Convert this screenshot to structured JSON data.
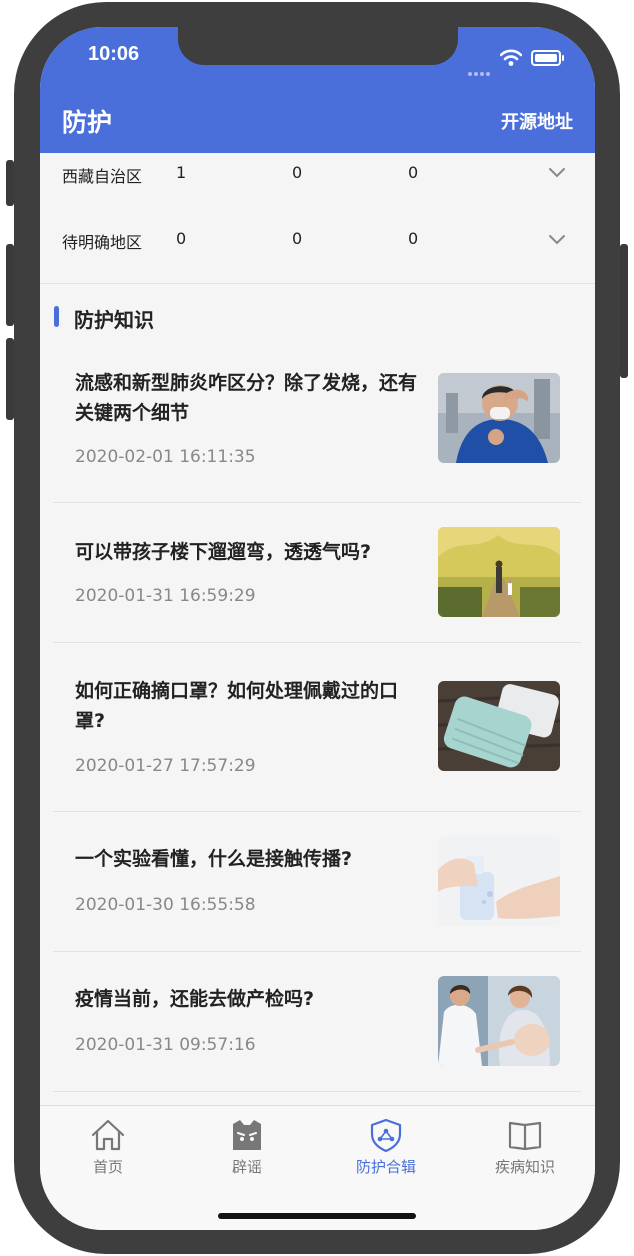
{
  "status_bar": {
    "time": "10:06"
  },
  "header": {
    "title": "防护",
    "link": "开源地址"
  },
  "regions": [
    {
      "name": "西藏自治区",
      "values": [
        "1",
        "0",
        "0"
      ]
    },
    {
      "name": "待明确地区",
      "values": [
        "0",
        "0",
        "0"
      ]
    }
  ],
  "section": {
    "title": "防护知识"
  },
  "articles": [
    {
      "title": "流感和新型肺炎咋区分？除了发烧，还有关键两个细节",
      "date": "2020-02-01 16:11:35"
    },
    {
      "title": "可以带孩子楼下遛遛弯，透透气吗?",
      "date": "2020-01-31 16:59:29"
    },
    {
      "title": "如何正确摘口罩？如何处理佩戴过的口罩?",
      "date": "2020-01-27 17:57:29"
    },
    {
      "title": "一个实验看懂，什么是接触传播?",
      "date": "2020-01-30 16:55:58"
    },
    {
      "title": "疫情当前，还能去做产检吗?",
      "date": "2020-01-31 09:57:16"
    }
  ],
  "tabs": [
    {
      "label": "首页",
      "icon": "home-icon",
      "active": false
    },
    {
      "label": "辟谣",
      "icon": "ghost-icon",
      "active": false
    },
    {
      "label": "防护合辑",
      "icon": "shield-icon",
      "active": true
    },
    {
      "label": "疾病知识",
      "icon": "book-icon",
      "active": false
    }
  ],
  "colors": {
    "accent": "#4a6fdb",
    "inactive": "#777777"
  }
}
